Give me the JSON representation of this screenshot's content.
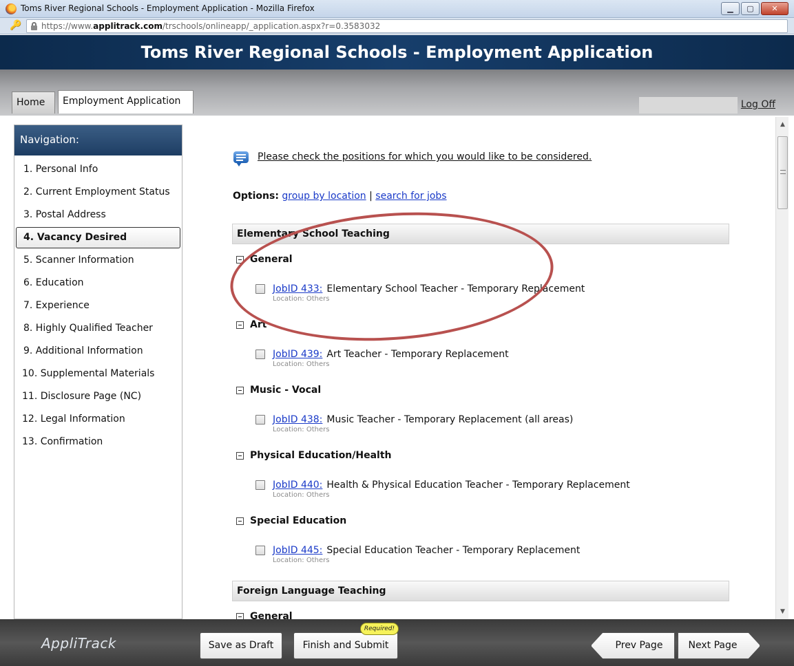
{
  "window": {
    "title": "Toms River Regional Schools - Employment Application - Mozilla Firefox",
    "url_prefix": "https://www.",
    "url_domain": "applitrack.com",
    "url_path": "/trschools/onlineapp/_application.aspx?r=0.3583032"
  },
  "header": {
    "title": "Toms River Regional Schools - Employment Application"
  },
  "tabs": [
    {
      "label": "Home"
    },
    {
      "label": "Employment Application"
    }
  ],
  "logoff_label": "Log Off",
  "sidebar": {
    "heading": "Navigation:",
    "items": [
      {
        "label": "1. Personal Info"
      },
      {
        "label": "2. Current Employment Status"
      },
      {
        "label": "3. Postal Address"
      },
      {
        "label": "4. Vacancy Desired"
      },
      {
        "label": "5. Scanner Information"
      },
      {
        "label": "6. Education"
      },
      {
        "label": "7. Experience"
      },
      {
        "label": "8. Highly Qualified Teacher"
      },
      {
        "label": "9. Additional Information"
      },
      {
        "label": "10. Supplemental Materials"
      },
      {
        "label": "11. Disclosure Page (NC)"
      },
      {
        "label": "12. Legal Information"
      },
      {
        "label": "13. Confirmation"
      }
    ],
    "active_item": "4. Vacancy Desired"
  },
  "content": {
    "intro": "Please check the positions for which you would like to be considered.",
    "options_label": "Options:",
    "option_group": "group by location",
    "option_separator": "|",
    "option_search": "search for jobs",
    "categories": [
      {
        "name": "Elementary School Teaching",
        "groups": [
          {
            "name": "General",
            "jobs": [
              {
                "id": "JobID 433:",
                "title": "Elementary School Teacher - Temporary Replacement",
                "location": "Location: Others"
              }
            ]
          },
          {
            "name": "Art",
            "jobs": [
              {
                "id": "JobID 439:",
                "title": "Art Teacher - Temporary Replacement",
                "location": "Location: Others"
              }
            ]
          },
          {
            "name": "Music - Vocal",
            "jobs": [
              {
                "id": "JobID 438:",
                "title": "Music Teacher - Temporary Replacement (all areas)",
                "location": "Location: Others"
              }
            ]
          },
          {
            "name": "Physical Education/Health",
            "jobs": [
              {
                "id": "JobID 440:",
                "title": "Health & Physical Education Teacher - Temporary Replacement",
                "location": "Location: Others"
              }
            ]
          },
          {
            "name": "Special Education",
            "jobs": [
              {
                "id": "JobID 445:",
                "title": "Special Education Teacher - Temporary Replacement",
                "location": "Location: Others"
              }
            ]
          }
        ]
      },
      {
        "name": "Foreign Language Teaching",
        "groups": [
          {
            "name": "General",
            "jobs": []
          }
        ]
      }
    ]
  },
  "footer": {
    "logo": "AppliTrack",
    "save_draft": "Save as Draft",
    "finish_submit": "Finish and Submit",
    "required_badge": "Required!",
    "prev_page": "Prev Page",
    "next_page": "Next Page"
  },
  "colors": {
    "header_blue": "#173e6b",
    "link_blue": "#1a3ac8",
    "highlight_ring": "#b8514f",
    "required_yellow": "#f6f25a"
  }
}
